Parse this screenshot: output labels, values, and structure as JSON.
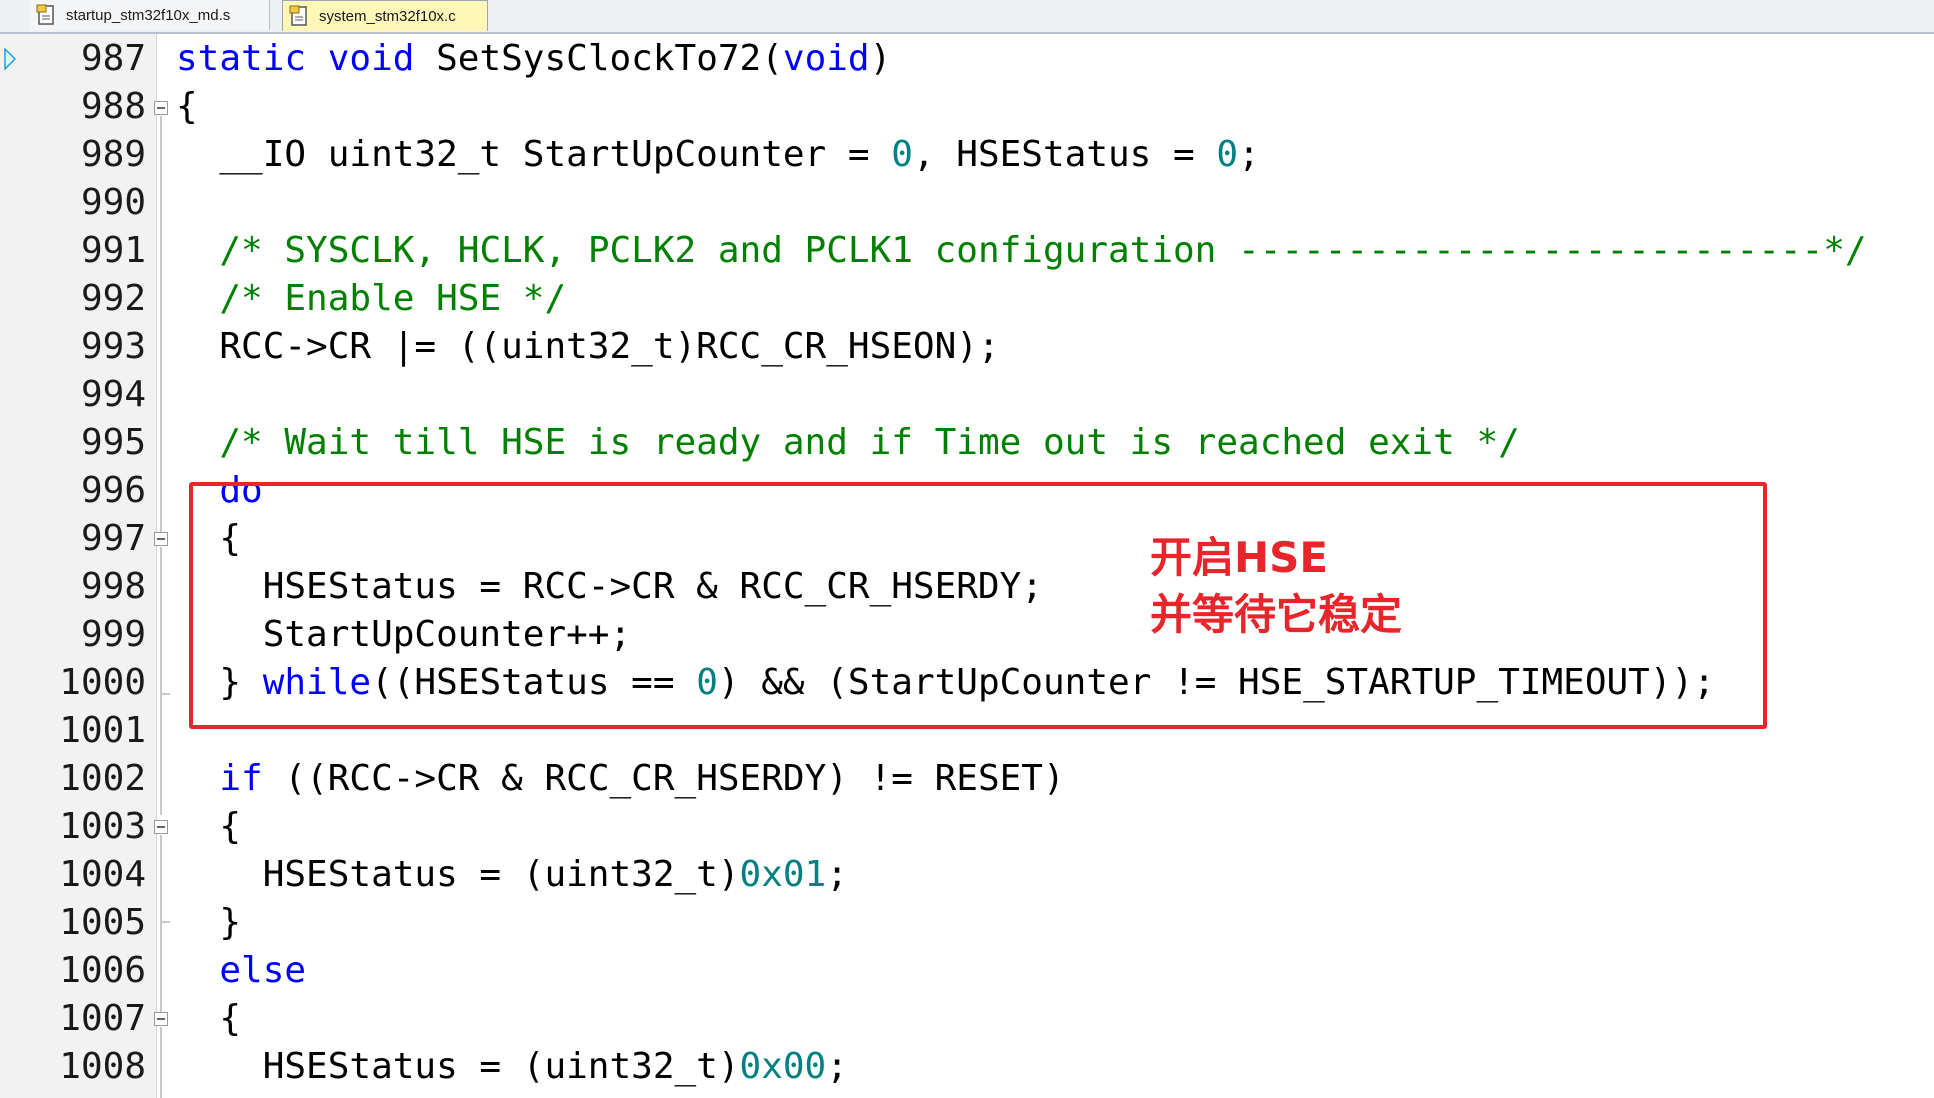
{
  "tabs": [
    {
      "label": "startup_stm32f10x_md.s",
      "active": false,
      "icon": "file-icon"
    },
    {
      "label": "system_stm32f10x.c",
      "active": true,
      "icon": "file-icon"
    }
  ],
  "colors": {
    "keyword": "#0000ff",
    "comment": "#008000",
    "number": "#008080",
    "annotation": "#e8252b",
    "active_tab": "#fff6b8"
  },
  "current_line_marker": "arrow-icon",
  "lines": [
    {
      "num": "987",
      "parts": [
        [
          "kw",
          "static"
        ],
        [
          "t",
          " "
        ],
        [
          "kw",
          "void"
        ],
        [
          "t",
          " SetSysClockTo72("
        ],
        [
          "kw",
          "void"
        ],
        [
          "t",
          ")"
        ]
      ]
    },
    {
      "num": "988",
      "parts": [
        [
          "t",
          "{"
        ]
      ]
    },
    {
      "num": "989",
      "parts": [
        [
          "t",
          "  __IO uint32_t StartUpCounter = "
        ],
        [
          "num",
          "0"
        ],
        [
          "t",
          ", HSEStatus = "
        ],
        [
          "num",
          "0"
        ],
        [
          "t",
          ";"
        ]
      ]
    },
    {
      "num": "990",
      "parts": []
    },
    {
      "num": "991",
      "parts": [
        [
          "t",
          "  "
        ],
        [
          "cm",
          "/* SYSCLK, HCLK, PCLK2 and PCLK1 configuration ---------------------------*/"
        ]
      ]
    },
    {
      "num": "992",
      "parts": [
        [
          "t",
          "  "
        ],
        [
          "cm",
          "/* Enable HSE */"
        ]
      ]
    },
    {
      "num": "993",
      "parts": [
        [
          "t",
          "  RCC->CR |= ((uint32_t)RCC_CR_HSEON);"
        ]
      ]
    },
    {
      "num": "994",
      "parts": []
    },
    {
      "num": "995",
      "parts": [
        [
          "t",
          "  "
        ],
        [
          "cm",
          "/* Wait till HSE is ready and if Time out is reached exit */"
        ]
      ]
    },
    {
      "num": "996",
      "parts": [
        [
          "t",
          "  "
        ],
        [
          "kw",
          "do"
        ]
      ]
    },
    {
      "num": "997",
      "parts": [
        [
          "t",
          "  {"
        ]
      ]
    },
    {
      "num": "998",
      "parts": [
        [
          "t",
          "    HSEStatus = RCC->CR & RCC_CR_HSERDY;"
        ]
      ]
    },
    {
      "num": "999",
      "parts": [
        [
          "t",
          "    StartUpCounter++;"
        ]
      ]
    },
    {
      "num": "1000",
      "parts": [
        [
          "t",
          "  } "
        ],
        [
          "kw",
          "while"
        ],
        [
          "t",
          "((HSEStatus == "
        ],
        [
          "num",
          "0"
        ],
        [
          "t",
          ") && (StartUpCounter != HSE_STARTUP_TIMEOUT));"
        ]
      ]
    },
    {
      "num": "1001",
      "parts": []
    },
    {
      "num": "1002",
      "parts": [
        [
          "t",
          "  "
        ],
        [
          "kw",
          "if"
        ],
        [
          "t",
          " ((RCC->CR & RCC_CR_HSERDY) != RESET)"
        ]
      ]
    },
    {
      "num": "1003",
      "parts": [
        [
          "t",
          "  {"
        ]
      ]
    },
    {
      "num": "1004",
      "parts": [
        [
          "t",
          "    HSEStatus = (uint32_t)"
        ],
        [
          "num",
          "0x01"
        ],
        [
          "t",
          ";"
        ]
      ]
    },
    {
      "num": "1005",
      "parts": [
        [
          "t",
          "  }"
        ]
      ]
    },
    {
      "num": "1006",
      "parts": [
        [
          "t",
          "  "
        ],
        [
          "kw",
          "else"
        ]
      ]
    },
    {
      "num": "1007",
      "parts": [
        [
          "t",
          "  {"
        ]
      ]
    },
    {
      "num": "1008",
      "parts": [
        [
          "t",
          "    HSEStatus = (uint32_t)"
        ],
        [
          "num",
          "0x00"
        ],
        [
          "t",
          ";"
        ]
      ]
    }
  ],
  "annotation": {
    "line1": "开启HSE",
    "line2": "并等待它稳定"
  }
}
